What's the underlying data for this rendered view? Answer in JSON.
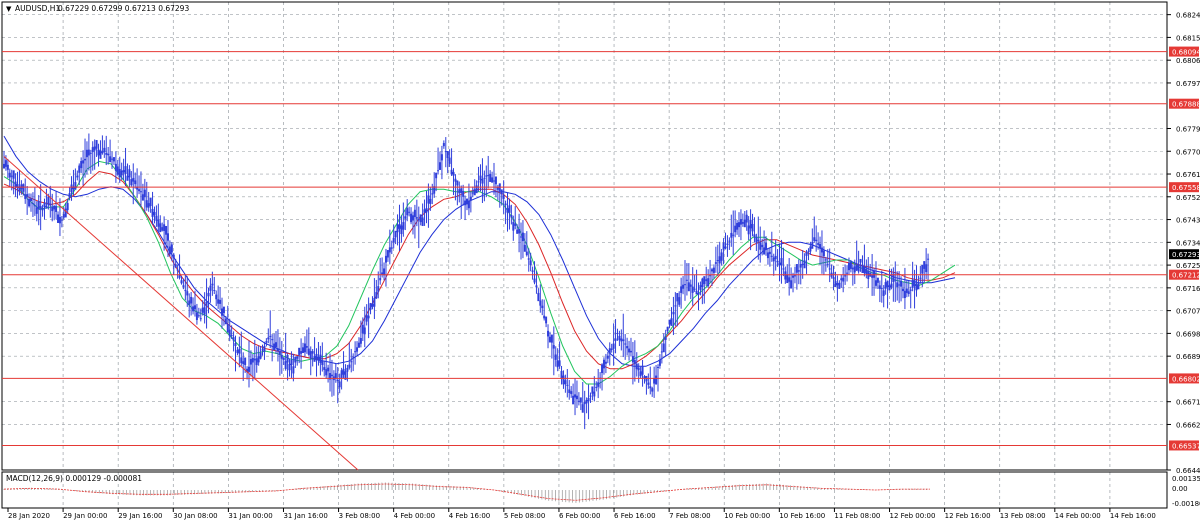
{
  "header": {
    "symbol_label": "AUDUSD,H1",
    "ohlc_label": "0.67229 0.67299 0.67213 0.67293",
    "menu_arrow": "▼"
  },
  "macd_panel": {
    "label": "MACD(12,26,9) 0.000129 -0.000081",
    "ticks": [
      "0.001357",
      "0.00",
      "-0.001807"
    ]
  },
  "colors": {
    "candles": "#2f3edb",
    "ma_fast": "#22c55e",
    "ma_mid": "#dc2626",
    "ma_slow": "#1d2fd6",
    "level_lines": "#e53935",
    "trendline": "#e53935",
    "grid": "#9aa0a6",
    "macd_hist": "#a0a0a0",
    "macd_signal": "#e53935"
  },
  "chart_data": {
    "type": "candlestick",
    "title": "AUDUSD,H1",
    "price_axis_ticks": [
      "0.68240",
      "0.68150",
      "0.68060",
      "0.67970",
      "0.67790",
      "0.67700",
      "0.67610",
      "0.67520",
      "0.67430",
      "0.67340",
      "0.67250",
      "0.67160",
      "0.67070",
      "0.66980",
      "0.66890",
      "0.66710",
      "0.66620",
      "0.66440"
    ],
    "ylim": [
      0.6644,
      0.6829
    ],
    "horizontal_levels": [
      "0.68094",
      "0.67888",
      "0.67558",
      "0.67212",
      "0.66802",
      "0.66537"
    ],
    "current_price": "0.67293",
    "x_tick_labels": [
      "28 Jan 2020",
      "29 Jan 00:00",
      "29 Jan 16:00",
      "30 Jan 08:00",
      "31 Jan 00:00",
      "31 Jan 16:00",
      "3 Feb 08:00",
      "4 Feb 00:00",
      "4 Feb 16:00",
      "5 Feb 08:00",
      "6 Feb 00:00",
      "6 Feb 16:00",
      "7 Feb 08:00",
      "10 Feb 00:00",
      "10 Feb 16:00",
      "11 Feb 08:00",
      "12 Feb 00:00",
      "12 Feb 16:00",
      "13 Feb 08:00",
      "14 Feb 00:00",
      "14 Feb 16:00"
    ],
    "close_path": [
      0.6765,
      0.6758,
      0.6752,
      0.6747,
      0.6749,
      0.6743,
      0.6756,
      0.6767,
      0.6771,
      0.6769,
      0.6763,
      0.6759,
      0.6753,
      0.6746,
      0.6737,
      0.6723,
      0.6711,
      0.6704,
      0.6717,
      0.6706,
      0.6693,
      0.6684,
      0.6689,
      0.6697,
      0.6688,
      0.6685,
      0.6694,
      0.6688,
      0.6683,
      0.6679,
      0.6687,
      0.6698,
      0.6712,
      0.6726,
      0.6738,
      0.6746,
      0.6742,
      0.6753,
      0.6772,
      0.6758,
      0.6749,
      0.6758,
      0.6761,
      0.6753,
      0.6742,
      0.6733,
      0.6717,
      0.6699,
      0.6685,
      0.6674,
      0.667,
      0.6675,
      0.6686,
      0.6698,
      0.6692,
      0.6683,
      0.6675,
      0.6694,
      0.6709,
      0.6719,
      0.6714,
      0.6721,
      0.673,
      0.6737,
      0.6743,
      0.6736,
      0.673,
      0.6726,
      0.6719,
      0.6725,
      0.6736,
      0.6727,
      0.6717,
      0.6723,
      0.6726,
      0.6721,
      0.6715,
      0.6719,
      0.6714,
      0.6718,
      0.6729
    ],
    "ma_fast": [
      0.676,
      0.6757,
      0.6751,
      0.6747,
      0.6748,
      0.6748,
      0.6755,
      0.6763,
      0.6766,
      0.6765,
      0.6759,
      0.6752,
      0.6744,
      0.6734,
      0.6722,
      0.6712,
      0.6707,
      0.6705,
      0.6702,
      0.6697,
      0.6692,
      0.669,
      0.6691,
      0.669,
      0.6688,
      0.6687,
      0.6688,
      0.6689,
      0.6693,
      0.6701,
      0.6712,
      0.6723,
      0.6733,
      0.6741,
      0.6749,
      0.6754,
      0.6755,
      0.6755,
      0.6754,
      0.6754,
      0.6754,
      0.6752,
      0.6749,
      0.6742,
      0.6733,
      0.672,
      0.6706,
      0.6693,
      0.6683,
      0.6678,
      0.6678,
      0.6681,
      0.6685,
      0.6688,
      0.669,
      0.6693,
      0.6699,
      0.6706,
      0.6712,
      0.6716,
      0.6721,
      0.6727,
      0.6732,
      0.6736,
      0.6736,
      0.6733,
      0.673,
      0.6727,
      0.6725,
      0.6726,
      0.6727,
      0.6727,
      0.6724,
      0.6722,
      0.6721,
      0.6719,
      0.6718,
      0.6717,
      0.6719,
      0.6722,
      0.6725
    ],
    "ma_mid": [
      0.6757,
      0.6755,
      0.6752,
      0.675,
      0.6749,
      0.675,
      0.6753,
      0.6758,
      0.6762,
      0.6761,
      0.6758,
      0.6752,
      0.6745,
      0.6737,
      0.6728,
      0.672,
      0.6714,
      0.6709,
      0.6705,
      0.6701,
      0.6697,
      0.6694,
      0.6692,
      0.6691,
      0.669,
      0.6689,
      0.6688,
      0.6688,
      0.669,
      0.6694,
      0.6701,
      0.671,
      0.6719,
      0.6728,
      0.6737,
      0.6744,
      0.6748,
      0.6751,
      0.6752,
      0.6754,
      0.6755,
      0.6755,
      0.6753,
      0.6749,
      0.6742,
      0.6733,
      0.6722,
      0.671,
      0.6699,
      0.6691,
      0.6686,
      0.6684,
      0.6684,
      0.6686,
      0.6689,
      0.6693,
      0.6698,
      0.6703,
      0.6709,
      0.6714,
      0.672,
      0.6725,
      0.6729,
      0.6733,
      0.6735,
      0.6735,
      0.6733,
      0.6731,
      0.6729,
      0.6728,
      0.6727,
      0.6726,
      0.6725,
      0.6724,
      0.6723,
      0.6722,
      0.672,
      0.6719,
      0.6719,
      0.672,
      0.6722
    ],
    "ma_slow": [
      0.6776,
      0.6768,
      0.6762,
      0.6758,
      0.6755,
      0.6753,
      0.6752,
      0.6753,
      0.6755,
      0.6756,
      0.6755,
      0.6751,
      0.6745,
      0.6738,
      0.673,
      0.6723,
      0.6716,
      0.6711,
      0.6707,
      0.6703,
      0.67,
      0.6697,
      0.6694,
      0.6692,
      0.669,
      0.6689,
      0.6688,
      0.6687,
      0.6686,
      0.6687,
      0.669,
      0.6695,
      0.6703,
      0.6712,
      0.6721,
      0.673,
      0.6737,
      0.6743,
      0.6747,
      0.675,
      0.6752,
      0.6754,
      0.6754,
      0.6753,
      0.675,
      0.6745,
      0.6737,
      0.6727,
      0.6716,
      0.6705,
      0.6696,
      0.669,
      0.6686,
      0.6685,
      0.6685,
      0.6687,
      0.669,
      0.6695,
      0.67,
      0.6706,
      0.6711,
      0.6717,
      0.6722,
      0.6727,
      0.6731,
      0.6733,
      0.6734,
      0.6734,
      0.6733,
      0.6731,
      0.6729,
      0.6727,
      0.6725,
      0.6723,
      0.6722,
      0.672,
      0.6719,
      0.6718,
      0.6718,
      0.6719,
      0.672
    ],
    "trendline_price": [
      0.676,
      0.665
    ],
    "macd_hist_approx": [
      0.0001,
      0.0002,
      0.0001,
      -0.0002,
      -0.0004,
      -0.0005,
      -0.0005,
      -0.0004,
      -0.0003,
      -0.0002,
      -0.0001,
      0.0002,
      0.0004,
      0.0006,
      0.0007,
      0.0006,
      0.0004,
      0.0003,
      0.0,
      -0.0005,
      -0.001,
      -0.0012,
      -0.0009,
      -0.0005,
      -0.0002,
      0.0001,
      0.0003,
      0.0005,
      0.0006,
      0.0004,
      0.0002,
      0.0001,
      0.0,
      0.0001,
      0.0001
    ]
  }
}
